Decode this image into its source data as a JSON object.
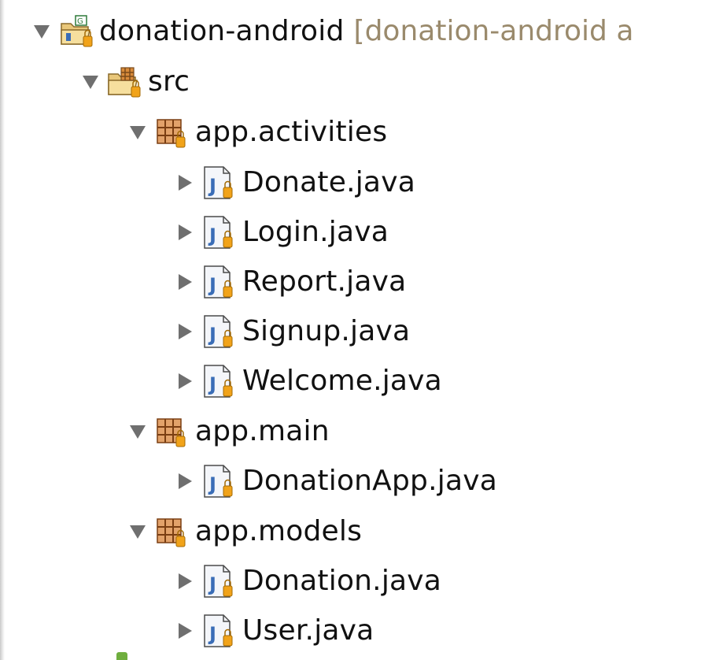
{
  "project": {
    "name": "donation-android",
    "decoration": "[donation-android a"
  },
  "src": {
    "label": "src"
  },
  "packages": [
    {
      "name": "app.activities",
      "files": [
        "Donate.java",
        "Login.java",
        "Report.java",
        "Signup.java",
        "Welcome.java"
      ]
    },
    {
      "name": "app.main",
      "files": [
        "DonationApp.java"
      ]
    },
    {
      "name": "app.models",
      "files": [
        "Donation.java",
        "User.java"
      ]
    }
  ],
  "icons": {
    "project": "java-project-icon",
    "source_folder": "source-folder-icon",
    "package": "package-icon",
    "java_file": "java-file-icon",
    "expanded": "triangle-down-icon",
    "collapsed": "triangle-right-icon"
  },
  "colors": {
    "text": "#111111",
    "decoration": "#9a8a6c",
    "twisty": "#6f6f6f",
    "package_brown": "#b0672a",
    "java_blue": "#3a6db7",
    "lock_orange": "#f1a31a"
  }
}
